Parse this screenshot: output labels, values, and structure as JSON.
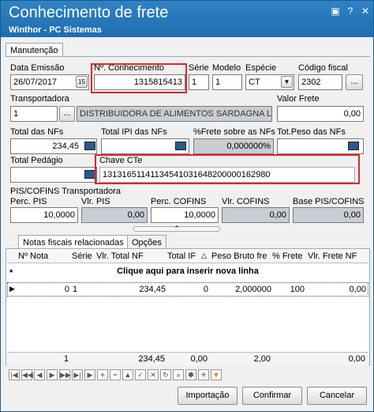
{
  "window": {
    "title": "Conhecimento de frete",
    "subtitle": "Winthor - PC Sistemas"
  },
  "tab_main": "Manutenção",
  "fields": {
    "data_emissao": {
      "label": "Data Emissão",
      "value": "26/07/2017"
    },
    "num_conhecimento": {
      "label": "Nº. Conhecimento",
      "value": "1315815413"
    },
    "serie": {
      "label": "Série",
      "value": "1"
    },
    "modelo": {
      "label": "Modelo",
      "value": "1"
    },
    "especie": {
      "label": "Espécie",
      "value": "CT"
    },
    "codigo_fiscal": {
      "label": "Código fiscal",
      "value": "2302"
    },
    "transportadora": {
      "label": "Transportadora",
      "code": "1",
      "name": "DISTRIBUIDORA DE ALIMENTOS SARDAGNA LTDA"
    },
    "valor_frete": {
      "label": "Valor Frete",
      "value": "0,00"
    },
    "total_nfs": {
      "label": "Total das NFs",
      "value": "234,45"
    },
    "total_ipi": {
      "label": "Total IPI das NFs",
      "value": ""
    },
    "perc_frete": {
      "label": "%Frete sobre as NFs",
      "value": "0,000000%"
    },
    "tot_peso": {
      "label": "Tot.Peso das NFs",
      "value": ""
    },
    "total_pedagio": {
      "label": "Total Pedágio",
      "value": ""
    },
    "chave_cte": {
      "label": "Chave CTe",
      "value": "13131651141134541031648200000162980"
    }
  },
  "pis_cofins": {
    "section": "PIS/COFINS Transportadora",
    "perc_pis": {
      "label": "Perc. PIS",
      "value": "10,0000"
    },
    "vlr_pis": {
      "label": "Vlr. PIS",
      "value": "0,00"
    },
    "perc_cofins": {
      "label": "Perc. COFINS",
      "value": "10,0000"
    },
    "vlr_cofins": {
      "label": "Vlr. COFINS",
      "value": "0,00"
    },
    "base": {
      "label": "Base PIS/COFINS",
      "value": "0,00"
    }
  },
  "tabs_lower": [
    "Notas fiscais relacionadas",
    "Opções"
  ],
  "grid": {
    "headers": [
      "Nº Nota",
      "Série",
      "Vlr. Total NF",
      "Total IF",
      "Peso Bruto fre",
      "% Frete",
      "Vlr. Frete NF"
    ],
    "new_row": "Clique aqui para inserir nova linha",
    "row": [
      "0",
      "1",
      "234,45",
      "0",
      "2,000000",
      "100",
      "0,00"
    ],
    "footer": [
      "1",
      "234,45",
      "0,00",
      "2,00",
      "0,00"
    ]
  },
  "buttons": {
    "importacao": "Importação",
    "confirmar": "Confirmar",
    "cancelar": "Cancelar"
  }
}
